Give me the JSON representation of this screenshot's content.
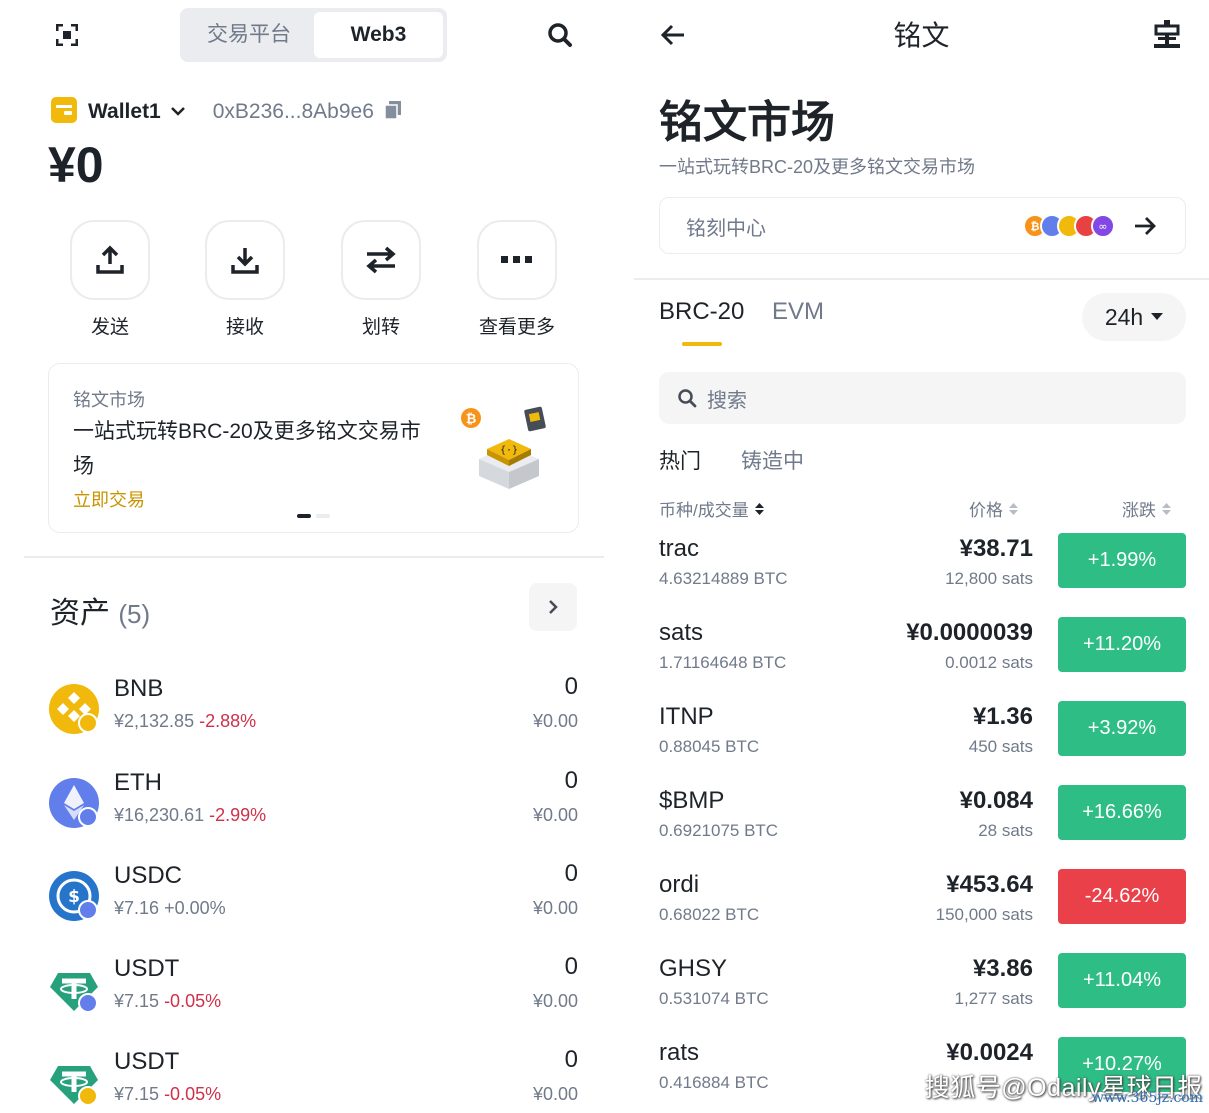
{
  "left": {
    "segment": {
      "exchange": "交易平台",
      "web3": "Web3"
    },
    "wallet": {
      "name": "Wallet1",
      "address": "0xB236...8Ab9e6"
    },
    "balance": "¥0",
    "actions": [
      {
        "label": "发送",
        "icon": "upload-icon"
      },
      {
        "label": "接收",
        "icon": "download-icon"
      },
      {
        "label": "划转",
        "icon": "transfer-icon"
      },
      {
        "label": "查看更多",
        "icon": "more-icon"
      }
    ],
    "banner": {
      "tag": "铭文市场",
      "title": "一站式玩转BRC-20及更多铭文交易市场",
      "link": "立即交易"
    },
    "assets": {
      "title": "资产",
      "count": "(5)",
      "items": [
        {
          "symbol": "BNB",
          "price": "¥2,132.85",
          "change": "-2.88%",
          "qty": "0",
          "value": "¥0.00",
          "icon": "bnb-icon",
          "color": "#f0b90b"
        },
        {
          "symbol": "ETH",
          "price": "¥16,230.61",
          "change": "-2.99%",
          "qty": "0",
          "value": "¥0.00",
          "icon": "eth-icon",
          "color": "#627eea"
        },
        {
          "symbol": "USDC",
          "price": "¥7.16",
          "change": "+0.00%",
          "qty": "0",
          "value": "¥0.00",
          "icon": "usdc-icon",
          "color": "#2775ca"
        },
        {
          "symbol": "USDT",
          "price": "¥7.15",
          "change": "-0.05%",
          "qty": "0",
          "value": "¥0.00",
          "icon": "usdt-icon",
          "color": "#26a17b"
        },
        {
          "symbol": "USDT",
          "price": "¥7.15",
          "change": "-0.05%",
          "qty": "0",
          "value": "¥0.00",
          "icon": "usdt-icon",
          "color": "#26a17b"
        }
      ]
    }
  },
  "right": {
    "header": {
      "title": "铭文"
    },
    "market_title": "铭文市场",
    "subtitle": "一站式玩转BRC-20及更多铭文交易市场",
    "mint_center": "铭刻中心",
    "tabs": [
      "BRC-20",
      "EVM"
    ],
    "period": "24h",
    "search_placeholder": "搜索",
    "sub_tabs": [
      "热门",
      "铸造中"
    ],
    "columns": {
      "coin": "币种/成交量",
      "price": "价格",
      "change": "涨跌"
    },
    "rows": [
      {
        "name": "trac",
        "volume": "4.63214889 BTC",
        "price": "¥38.71",
        "sats": "12,800 sats",
        "change": "+1.99%",
        "dir": "up"
      },
      {
        "name": "sats",
        "volume": "1.71164648 BTC",
        "price": "¥0.0000039",
        "sats": "0.0012 sats",
        "change": "+11.20%",
        "dir": "up"
      },
      {
        "name": "ITNP",
        "volume": "0.88045 BTC",
        "price": "¥1.36",
        "sats": "450 sats",
        "change": "+3.92%",
        "dir": "up"
      },
      {
        "name": "$BMP",
        "volume": "0.6921075 BTC",
        "price": "¥0.084",
        "sats": "28 sats",
        "change": "+16.66%",
        "dir": "up"
      },
      {
        "name": "ordi",
        "volume": "0.68022 BTC",
        "price": "¥453.64",
        "sats": "150,000 sats",
        "change": "-24.62%",
        "dir": "down"
      },
      {
        "name": "GHSY",
        "volume": "0.531074 BTC",
        "price": "¥3.86",
        "sats": "1,277 sats",
        "change": "+11.04%",
        "dir": "up"
      },
      {
        "name": "rats",
        "volume": "0.416884 BTC",
        "price": "¥0.0024",
        "sats": "",
        "change": "+10.27%",
        "dir": "up"
      }
    ],
    "colors": {
      "up": "#2ebd85",
      "down": "#e9404a",
      "accent": "#f0b90b"
    }
  },
  "watermark": {
    "text": "搜狐号@Odaily星球日报",
    "site": "www.365jz.com"
  }
}
